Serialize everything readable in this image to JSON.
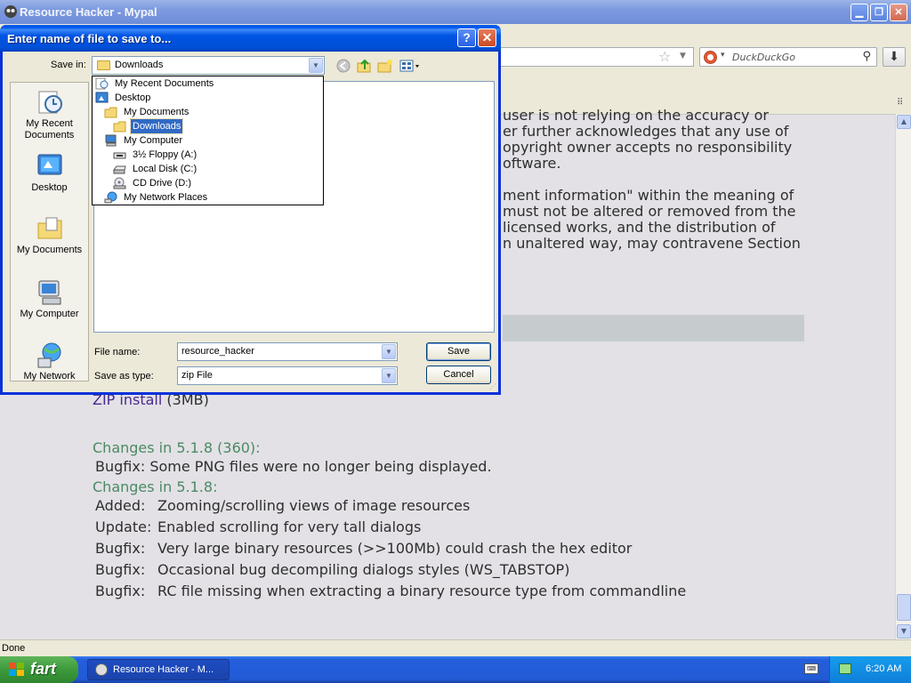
{
  "browser": {
    "title": "Resource Hacker - Mypal",
    "search_placeholder": "DuckDuckGo",
    "status": "Done"
  },
  "page": {
    "license_lines": [
      "user is not relying on the accuracy or",
      "er further acknowledges that any use of",
      "opyright owner accepts no responsibility",
      "oftware.",
      "",
      "ment information\" within the meaning of",
      "must not be altered or removed from the",
      "licensed works, and the distribution of",
      "n unaltered way, may contravene Section"
    ],
    "zip_link": "ZIP install",
    "zip_size": " (3MB)",
    "sections": [
      {
        "heading": "Changes in 5.1.8 (360):",
        "items": [
          {
            "kind": "Bugfix:",
            "text": "Some PNG files were no longer being displayed."
          }
        ]
      },
      {
        "heading": "Changes in 5.1.8:",
        "items": [
          {
            "kind": "Added:",
            "text": "Zooming/scrolling views of image resources"
          },
          {
            "kind": "Update:",
            "text": "Enabled scrolling for very tall dialogs"
          },
          {
            "kind": "Bugfix:",
            "text": "Very large binary resources (>>100Mb) could crash the hex editor"
          },
          {
            "kind": "Bugfix:",
            "text": "Occasional bug decompiling dialogs styles (WS_TABSTOP)"
          },
          {
            "kind": "Bugfix:",
            "text": "RC file missing when extracting a binary resource type from commandline"
          }
        ]
      }
    ]
  },
  "dialog": {
    "title": "Enter name of file to save to...",
    "help_label": "?",
    "close_label": "✕",
    "save_in_label": "Save in:",
    "save_in_value": "Downloads",
    "dropdown_items": [
      "My Recent Documents",
      "Desktop",
      "My Documents",
      "Downloads",
      "My Computer",
      "3½ Floppy (A:)",
      "Local Disk (C:)",
      "CD Drive (D:)",
      "My Network Places"
    ],
    "places": [
      "My Recent Documents",
      "Desktop",
      "My Documents",
      "My Computer",
      "My Network"
    ],
    "file_name_label": "File name:",
    "file_name_value": "resource_hacker",
    "save_as_type_label": "Save as type:",
    "save_as_type_value": "zip File",
    "save_button": "Save",
    "cancel_button": "Cancel"
  },
  "taskbar": {
    "start_label": "fart",
    "task_label": "Resource Hacker - M...",
    "clock": "6:20 AM"
  },
  "colors": {
    "dialog_title_blue": "#0054e3",
    "heading_green": "#4a8a63",
    "link_purple": "#4b2a8e",
    "selection_blue": "#316ac5"
  }
}
